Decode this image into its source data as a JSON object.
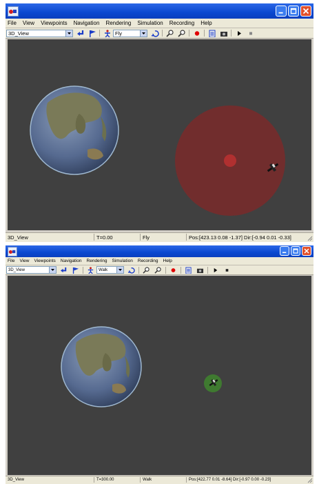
{
  "window_top": {
    "menu": [
      "File",
      "View",
      "Viewpoints",
      "Navigation",
      "Rendering",
      "Simulation",
      "Recording",
      "Help"
    ],
    "viewpoint_select": "3D_View",
    "nav_mode_select": "Fly",
    "status": {
      "view": "3D_View",
      "time": "T=0.00",
      "mode": "Fly",
      "pos_dir": "Pos:[423.13 0.08 -1.37] Dir:[-0.94 0.01 -0.33]"
    },
    "sphere_color": "#7a2a2a"
  },
  "window_bottom": {
    "menu": [
      "File",
      "View",
      "Viewpoints",
      "Navigation",
      "Rendering",
      "Simulation",
      "Recording",
      "Help"
    ],
    "viewpoint_select": "3D_View",
    "nav_mode_select": "Walk",
    "status": {
      "view": "3D_View",
      "time": "T=300.00",
      "mode": "Walk",
      "pos_dir": "Pos:[422.77 0.01 -8.64] Dir:[-0.97 0.00 -0.23]"
    },
    "sphere_color": "#3f7a30"
  },
  "colors": {
    "title_blue": "#0a48d0",
    "viewport_bg": "#404040",
    "record_red": "#e00000"
  },
  "icons": [
    "app-icon",
    "minimize-icon",
    "maximize-icon",
    "close-icon",
    "dropdown-arrow-icon",
    "return-arrow-icon",
    "flag-icon",
    "walker-icon",
    "undo-icon",
    "zoom-in-icon",
    "zoom-out-icon",
    "record-icon",
    "clipboard-icon",
    "camera-icon",
    "play-icon",
    "stop-icon",
    "earth-icon",
    "satellite-icon"
  ]
}
